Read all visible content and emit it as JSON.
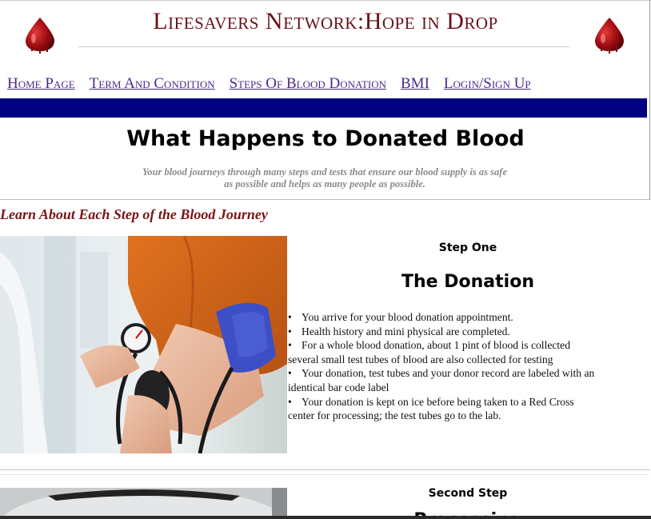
{
  "header": {
    "title": "Lifesavers Network:Hope in Drop"
  },
  "nav": {
    "items": [
      {
        "label": "Home Page"
      },
      {
        "label": "Term And Condition"
      },
      {
        "label": "Steps Of Blood Donation"
      },
      {
        "label": "BMI"
      },
      {
        "label": "Login/Sign Up"
      }
    ]
  },
  "hero": {
    "heading": "What Happens to Donated Blood",
    "subheading": "Your blood journeys through many steps and tests that ensure our blood supply is as safe as possible and helps as many people as possible."
  },
  "section": {
    "heading": "Learn About Each Step of the Blood Journey"
  },
  "steps": [
    {
      "label": "Step One",
      "title": "The Donation",
      "bullets": [
        "You arrive for your blood donation appointment.",
        "Health history and mini physical are completed.",
        "For a whole blood donation, about 1 pint of blood is collected several small test tubes of blood are also collected for testing",
        "Your donation, test tubes and your donor record are labeled with an identical bar code label",
        "Your donation is kept on ice before being taken to a Red Cross center for processing; the test tubes go to the lab."
      ]
    },
    {
      "label": "Second Step",
      "title": "Processing"
    }
  ],
  "colors": {
    "brand_maroon": "#6b0f1a",
    "nav_link": "#4b2b8a",
    "nav_bar": "#000080",
    "section_heading": "#7a1414"
  },
  "icons": {
    "logo_left": "blood-drop-icon",
    "logo_right": "blood-drop-icon"
  }
}
